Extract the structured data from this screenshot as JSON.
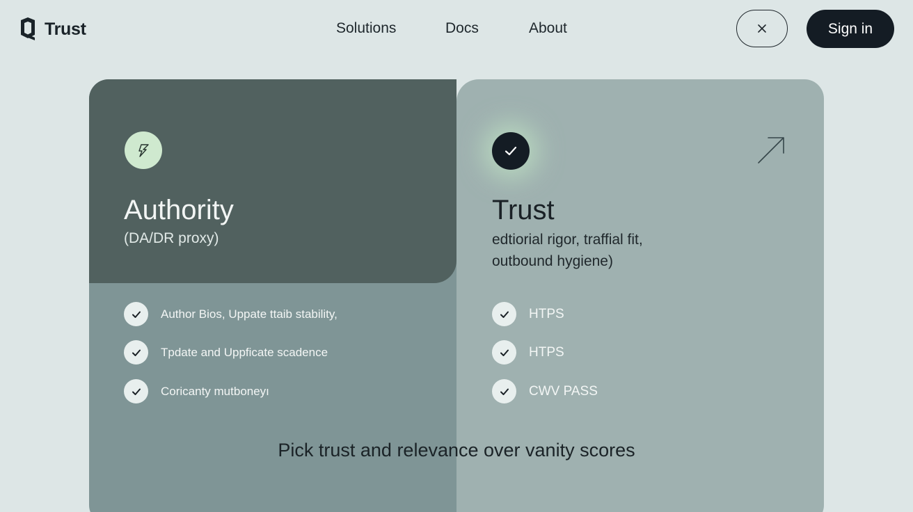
{
  "brand": {
    "name": "Trust"
  },
  "nav": {
    "items": [
      "Solutions",
      "Docs",
      "About"
    ]
  },
  "header": {
    "close_icon": "close-icon",
    "signin_label": "Sign in"
  },
  "card": {
    "authority": {
      "icon": "bolt-icon",
      "title": "Authority",
      "subtitle": "(DA/DR proxy)",
      "items": [
        "Author Bios, Uppate ttaib stability,",
        "Tpdate and Uppficate scadence",
        "Coricanty mutboneyı"
      ]
    },
    "trust": {
      "icon": "check-icon",
      "title": "Trust",
      "subtitle": "edtiorial rigor, traffial fit, outbound hygiene)",
      "items": [
        "HTPS",
        "HTPS",
        "CWV PASS"
      ],
      "corner_icon": "arrow-up-right-icon"
    },
    "tagline": "Pick trust and relevance over vanity scores"
  },
  "colors": {
    "background": "#dde6e6",
    "dark_button": "#141c24",
    "authority_panel": "#51615f",
    "lower_left_panel": "#7f9596",
    "trust_panel": "#9fb1b0",
    "mint_accent": "#cfe9cf"
  }
}
